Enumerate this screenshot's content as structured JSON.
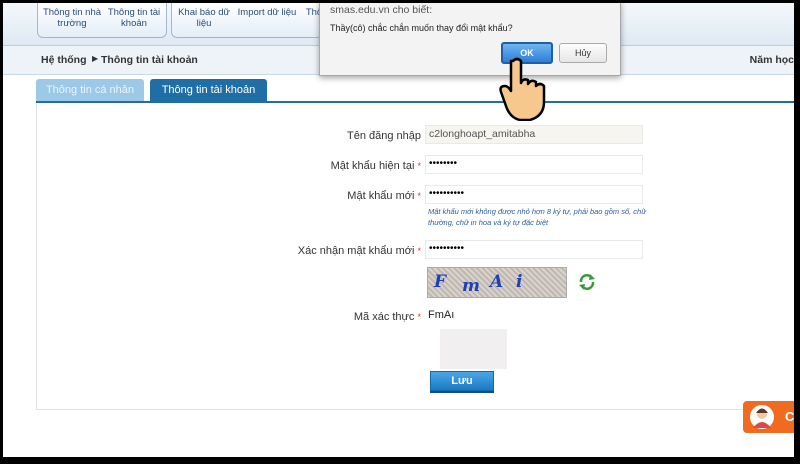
{
  "menu": {
    "items": [
      {
        "label": "Thông tin nhà trường"
      },
      {
        "label": "Thông tin tài khoản"
      },
      {
        "label": "Khai báo dữ liệu"
      },
      {
        "label": "Import dữ liệu"
      },
      {
        "label": "Thố"
      }
    ]
  },
  "breadcrumb": {
    "root": "Hệ thống",
    "current": "Thông tin tài khoản"
  },
  "header": {
    "year_label": "Năm học"
  },
  "tabs": [
    {
      "label": "Thông tin cá nhân",
      "active": false
    },
    {
      "label": "Thông tin tài khoản",
      "active": true
    }
  ],
  "form": {
    "username_label": "Tên đăng nhập",
    "username_value": "c2longhoapt_amitabha",
    "current_password_label": "Mật khẩu hiện tại",
    "current_password_value": "••••••••",
    "new_password_label": "Mật khẩu mới",
    "new_password_value": "••••••••••",
    "new_password_hint": "Mật khẩu mới không được nhỏ hơn 8 ký tự, phải bao gồm số, chữ thường, chữ in hoa và ký tự đặc biệt",
    "confirm_password_label": "Xác nhận mật khẩu mới",
    "confirm_password_value": "••••••••••",
    "captcha_chars": [
      "F",
      "m",
      "A",
      "i"
    ],
    "captcha_label": "Mã xác thực",
    "captcha_value": "FmAı",
    "required_mark": "*",
    "save_label": "Lưu"
  },
  "dialog": {
    "title": "smas.edu.vn cho biết:",
    "message": "Thầy(cô) chắc chắn muốn thay đổi mật khẩu?",
    "ok_label": "OK",
    "cancel_label": "Hủy"
  },
  "chat": {
    "label": "C"
  },
  "icons": {
    "refresh": "refresh-icon",
    "cursor": "hand-pointer-icon",
    "avatar": "support-agent-icon"
  },
  "colors": {
    "tab_active": "#1f6fa6",
    "save_button": "#1a79c4",
    "hint_text": "#2e5d9e",
    "chat": "#f06a20"
  }
}
